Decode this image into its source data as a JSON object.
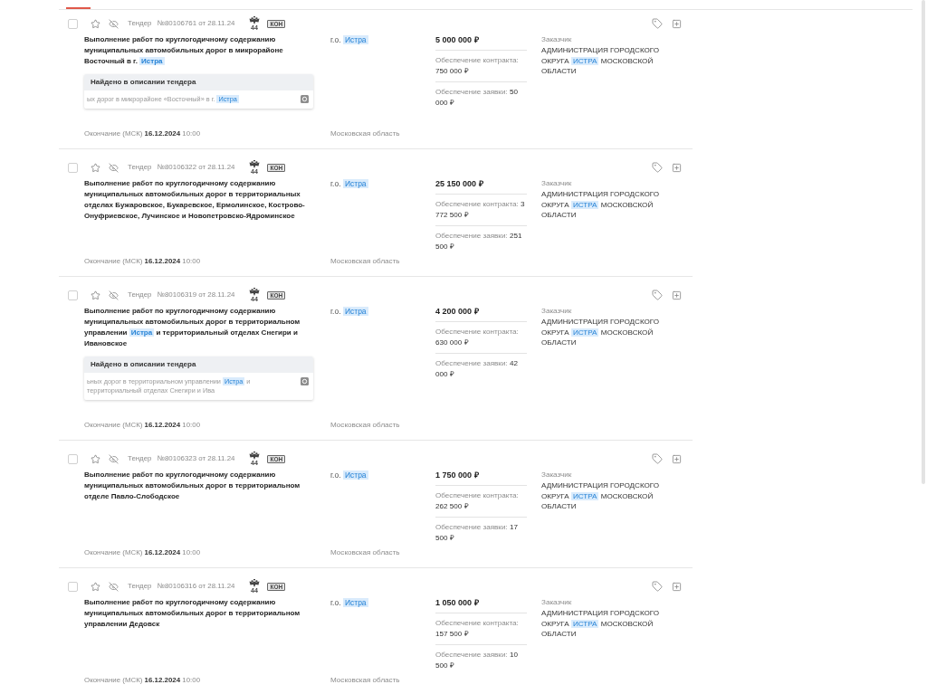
{
  "tenders": [
    {
      "checked": false,
      "favorite": false,
      "type": "Тендер",
      "number": "№80106761 от 28.11.24",
      "law": "44",
      "procedure": "КОН",
      "title": [
        {
          "text": "Выполнение работ по круглогодичному содержанию муниципальных автомобильных дорог в микрорайоне Восточный в г. ",
          "highlighted": false
        },
        {
          "text": "Истра",
          "highlighted": true
        }
      ],
      "found": {
        "heading": "Найдено в описании тендера",
        "snippet": [
          {
            "text": "ых дорог в микрорайоне «Восточный» в г. ",
            "highlighted": false
          },
          {
            "text": "Истра",
            "highlighted": true
          }
        ]
      },
      "region": [
        {
          "text": "г.о. ",
          "highlighted": false
        },
        {
          "text": "Истра",
          "highlighted": true
        }
      ],
      "price": "5 000 000 ₽",
      "contract_security": {
        "label": "Обеспечение контракта:",
        "value": "750 000 ₽"
      },
      "bid_security": {
        "label": "Обеспечение заявки:",
        "value": "50 000 ₽"
      },
      "customer": {
        "label": "Заказчик",
        "name": [
          {
            "text": "АДМИНИСТРАЦИЯ ГОРОДСКОГО ОКРУГА ",
            "highlighted": false
          },
          {
            "text": "ИСТРА",
            "highlighted": true
          },
          {
            "text": " МОСКОВСКОЙ ОБЛАСТИ",
            "highlighted": false
          }
        ]
      },
      "deadline": "Окончание (МСК) **16.12.2024** 10:00",
      "area": "Московская область"
    },
    {
      "checked": false,
      "favorite": false,
      "type": "Тендер",
      "number": "№80106322 от 28.11.24",
      "law": "44",
      "procedure": "КОН",
      "title": [
        {
          "text": "Выполнение работ по круглогодичному содержанию муниципальных автомобильных дорог в территориальных отделах Бужаровское, Букаревское, Ермолинское, Кострово-Онуфриевское, Лучинское и Новопетровско-Ядроминское",
          "highlighted": false
        }
      ],
      "region": [
        {
          "text": "г.о. ",
          "highlighted": false
        },
        {
          "text": "Истра",
          "highlighted": true
        }
      ],
      "price": "25 150 000 ₽",
      "contract_security": {
        "label": "Обеспечение контракта:",
        "value": "3 772 500 ₽"
      },
      "bid_security": {
        "label": "Обеспечение заявки:",
        "value": "251 500 ₽"
      },
      "customer": {
        "label": "Заказчик",
        "name": [
          {
            "text": "АДМИНИСТРАЦИЯ ГОРОДСКОГО ОКРУГА ",
            "highlighted": false
          },
          {
            "text": "ИСТРА",
            "highlighted": true
          },
          {
            "text": " МОСКОВСКОЙ ОБЛАСТИ",
            "highlighted": false
          }
        ]
      },
      "deadline": "Окончание (МСК) **16.12.2024** 10:00",
      "area": "Московская область"
    },
    {
      "checked": false,
      "favorite": false,
      "type": "Тендер",
      "number": "№80106319 от 28.11.24",
      "law": "44",
      "procedure": "КОН",
      "title": [
        {
          "text": "Выполнение работ по круглогодичному содержанию муниципальных автомобильных дорог в территориальном управлении ",
          "highlighted": false
        },
        {
          "text": "Истра",
          "highlighted": true
        },
        {
          "text": " и территориальный отделах Снегири и Ивановское",
          "highlighted": false
        }
      ],
      "found": {
        "heading": "Найдено в описании тендера",
        "snippet": [
          {
            "text": "ьных дорог в территориальном управлении ",
            "highlighted": false
          },
          {
            "text": "Истра",
            "highlighted": true
          },
          {
            "text": " и территориальный отделах Снегири и Ива",
            "highlighted": false
          }
        ]
      },
      "region": [
        {
          "text": "г.о. ",
          "highlighted": false
        },
        {
          "text": "Истра",
          "highlighted": true
        }
      ],
      "price": "4 200 000 ₽",
      "contract_security": {
        "label": "Обеспечение контракта:",
        "value": "630 000 ₽"
      },
      "bid_security": {
        "label": "Обеспечение заявки:",
        "value": "42 000 ₽"
      },
      "customer": {
        "label": "Заказчик",
        "name": [
          {
            "text": "АДМИНИСТРАЦИЯ ГОРОДСКОГО ОКРУГА ",
            "highlighted": false
          },
          {
            "text": "ИСТРА",
            "highlighted": true
          },
          {
            "text": " МОСКОВСКОЙ ОБЛАСТИ",
            "highlighted": false
          }
        ]
      },
      "deadline": "Окончание (МСК) **16.12.2024** 10:00",
      "area": "Московская область"
    },
    {
      "checked": false,
      "favorite": false,
      "type": "Тендер",
      "number": "№80106323 от 28.11.24",
      "law": "44",
      "procedure": "КОН",
      "title": [
        {
          "text": "Выполнение работ по круглогодичному содержанию муниципальных автомобильных дорог в территориальном отделе Павло-Слободское",
          "highlighted": false
        }
      ],
      "region": [
        {
          "text": "г.о. ",
          "highlighted": false
        },
        {
          "text": "Истра",
          "highlighted": true
        }
      ],
      "price": "1 750 000 ₽",
      "contract_security": {
        "label": "Обеспечение контракта:",
        "value": "262 500 ₽"
      },
      "bid_security": {
        "label": "Обеспечение заявки:",
        "value": "17 500 ₽"
      },
      "customer": {
        "label": "Заказчик",
        "name": [
          {
            "text": "АДМИНИСТРАЦИЯ ГОРОДСКОГО ОКРУГА ",
            "highlighted": false
          },
          {
            "text": "ИСТРА",
            "highlighted": true
          },
          {
            "text": " МОСКОВСКОЙ ОБЛАСТИ",
            "highlighted": false
          }
        ]
      },
      "deadline": "Окончание (МСК) **16.12.2024** 10:00",
      "area": "Московская область"
    },
    {
      "checked": false,
      "favorite": false,
      "type": "Тендер",
      "number": "№80106316 от 28.11.24",
      "law": "44",
      "procedure": "КОН",
      "title": [
        {
          "text": "Выполнение работ по круглогодичному содержанию муниципальных автомобильных дорог в территориальном управлении Дедовск",
          "highlighted": false
        }
      ],
      "region": [
        {
          "text": "г.о. ",
          "highlighted": false
        },
        {
          "text": "Истра",
          "highlighted": true
        }
      ],
      "price": "1 050 000 ₽",
      "contract_security": {
        "label": "Обеспечение контракта:",
        "value": "157 500 ₽"
      },
      "bid_security": {
        "label": "Обеспечение заявки:",
        "value": "10 500 ₽"
      },
      "customer": {
        "label": "Заказчик",
        "name": [
          {
            "text": "АДМИНИСТРАЦИЯ ГОРОДСКОГО ОКРУГА ",
            "highlighted": false
          },
          {
            "text": "ИСТРА",
            "highlighted": true
          },
          {
            "text": " МОСКОВСКОЙ ОБЛАСТИ",
            "highlighted": false
          }
        ]
      },
      "deadline": "Окончание (МСК) **16.12.2024** 10:00",
      "area": "Московская область"
    }
  ]
}
